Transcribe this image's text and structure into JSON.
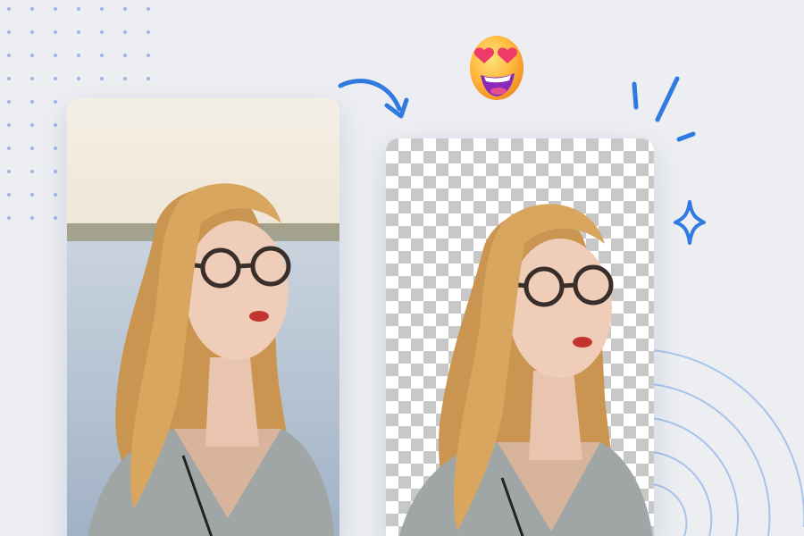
{
  "scene": {
    "description_free": true,
    "colors": {
      "background": "#eceef2",
      "accent": "#2f7be0",
      "dot": "#9fb7e3",
      "ring": "#a9c3ec",
      "checker_light": "#ffffff",
      "checker_dark": "#c8c8c8"
    }
  },
  "cards": {
    "original": {
      "icon": "portrait-photo"
    },
    "result": {
      "icon": "portrait-cutout-transparent"
    }
  },
  "decor": {
    "arrow_icon": "curved-arrow",
    "emoji_icon": "heart-eyes-emoji",
    "sparkle_icon": "sparkle-star",
    "burst_icon": "burst-lines",
    "rings_icon": "concentric-arcs"
  }
}
